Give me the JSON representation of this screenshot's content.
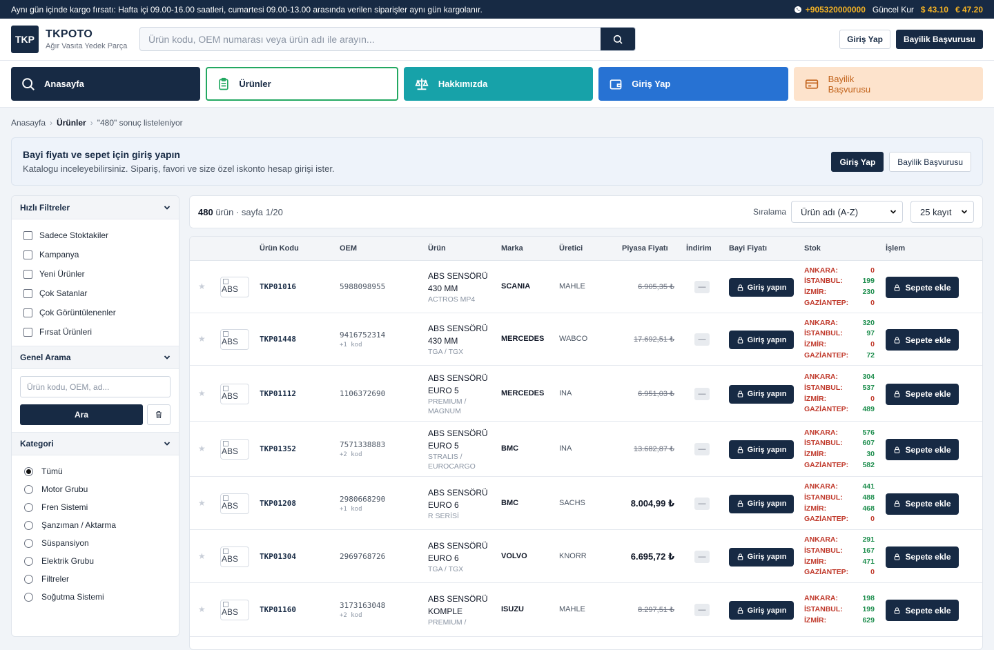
{
  "topbar": {
    "announcement": "Aynı gün içinde kargo fırsatı: Hafta içi 09.00-16.00 saatleri, cumartesi 09.00-13.00 arasında verilen siparişler aynı gün kargolanır.",
    "phone": "+905320000000",
    "rate_label": "Güncel Kur",
    "usd": "$ 43.10",
    "eur": "€ 47.20"
  },
  "header": {
    "logo": "TKP",
    "brand_name": "TKPOTO",
    "brand_sub": "Ağır Vasıta Yedek Parça",
    "search_placeholder": "Ürün kodu, OEM numarası veya ürün adı ile arayın...",
    "login": "Giriş Yap",
    "dealer": "Bayilik Başvurusu"
  },
  "nav": [
    {
      "label": "Anasayfa",
      "icon": "search-icon"
    },
    {
      "label": "Ürünler",
      "icon": "clipboard-icon"
    },
    {
      "label": "Hakkımızda",
      "icon": "scale-icon"
    },
    {
      "label": "Giriş Yap",
      "icon": "wallet-icon"
    },
    {
      "label": "Bayilik Başvurusu",
      "icon": "card-icon"
    }
  ],
  "breadcrumb": {
    "home": "Anasayfa",
    "current": "Ürünler",
    "result": "\"480\" sonuç listeleniyor"
  },
  "banner": {
    "title": "Bayi fiyatı ve sepet için giriş yapın",
    "subtitle": "Katalogu inceleyebilirsiniz. Sipariş, favori ve size özel iskonto hesap girişi ister.",
    "login": "Giriş Yap",
    "dealer": "Bayilik Başvurusu"
  },
  "sidebar": {
    "quick_title": "Hızlı Filtreler",
    "quick": [
      "Sadece Stoktakiler",
      "Kampanya",
      "Yeni Ürünler",
      "Çok Satanlar",
      "Çok Görüntülenenler",
      "Fırsat Ürünleri"
    ],
    "search_title": "Genel Arama",
    "search_placeholder": "Ürün kodu, OEM, ad...",
    "search_btn": "Ara",
    "category_title": "Kategori",
    "categories": [
      "Tümü",
      "Motor Grubu",
      "Fren Sistemi",
      "Şanzıman / Aktarma",
      "Süspansiyon",
      "Elektrik Grubu",
      "Filtreler",
      "Soğutma Sistemi"
    ]
  },
  "list": {
    "count": "480",
    "count_suffix": "ürün · sayfa 1/20",
    "sort_label": "Sıralama",
    "sort_value": "Ürün adı (A-Z)",
    "per_page": "25 kayıt"
  },
  "table": {
    "headers": [
      "Ürün Kodu",
      "OEM",
      "Ürün",
      "Marka",
      "Üretici",
      "Piyasa Fiyatı",
      "İndirim",
      "Bayi Fiyatı",
      "Stok",
      "İşlem"
    ],
    "login_btn": "Giriş yapın",
    "cart_btn": "Sepete ekle",
    "img_alt": "ABS",
    "discount": "—",
    "stock_labels": [
      "ANKARA:",
      "İSTANBUL:",
      "İZMİR:",
      "GAZİANTEP:"
    ],
    "rows": [
      {
        "code": "TKP01016",
        "oem": "5988098955",
        "oem_extra": "",
        "name": [
          "ABS SENSÖRÜ",
          "430 MM"
        ],
        "model": [
          "ACTROS MP4"
        ],
        "brand": "SCANIA",
        "maker": "MAHLE",
        "price": "6.905,35 ₺",
        "strike": true,
        "stock": [
          0,
          199,
          230,
          0
        ]
      },
      {
        "code": "TKP01448",
        "oem": "9416752314",
        "oem_extra": "+1 kod",
        "name": [
          "ABS SENSÖRÜ",
          "430 MM"
        ],
        "model": [
          "TGA / TGX"
        ],
        "brand": "MERCEDES",
        "maker": "WABCO",
        "price": "17.692,51 ₺",
        "strike": true,
        "stock": [
          320,
          97,
          0,
          72
        ]
      },
      {
        "code": "TKP01112",
        "oem": "1106372690",
        "oem_extra": "",
        "name": [
          "ABS SENSÖRÜ",
          "EURO 5"
        ],
        "model": [
          "PREMIUM /",
          "MAGNUM"
        ],
        "brand": "MERCEDES",
        "maker": "INA",
        "price": "6.951,03 ₺",
        "strike": true,
        "stock": [
          304,
          537,
          0,
          489
        ]
      },
      {
        "code": "TKP01352",
        "oem": "7571338883",
        "oem_extra": "+2 kod",
        "name": [
          "ABS SENSÖRÜ",
          "EURO 5"
        ],
        "model": [
          "STRALIS /",
          "EUROCARGO"
        ],
        "brand": "BMC",
        "maker": "INA",
        "price": "13.682,87 ₺",
        "strike": true,
        "stock": [
          576,
          607,
          30,
          582
        ]
      },
      {
        "code": "TKP01208",
        "oem": "2980668290",
        "oem_extra": "+1 kod",
        "name": [
          "ABS SENSÖRÜ",
          "EURO 6"
        ],
        "model": [
          "R SERİSİ"
        ],
        "brand": "BMC",
        "maker": "SACHS",
        "price": "8.004,99 ₺",
        "strike": false,
        "stock": [
          441,
          488,
          468,
          0
        ]
      },
      {
        "code": "TKP01304",
        "oem": "2969768726",
        "oem_extra": "",
        "name": [
          "ABS SENSÖRÜ",
          "EURO 6"
        ],
        "model": [
          "TGA / TGX"
        ],
        "brand": "VOLVO",
        "maker": "KNORR",
        "price": "6.695,72 ₺",
        "strike": false,
        "stock": [
          291,
          167,
          471,
          0
        ]
      },
      {
        "code": "TKP01160",
        "oem": "3173163048",
        "oem_extra": "+2 kod",
        "name": [
          "ABS SENSÖRÜ",
          "KOMPLE"
        ],
        "model": [
          "PREMIUM /"
        ],
        "brand": "ISUZU",
        "maker": "MAHLE",
        "price": "8.297,51 ₺",
        "strike": true,
        "stock": [
          198,
          199,
          629
        ]
      }
    ]
  }
}
